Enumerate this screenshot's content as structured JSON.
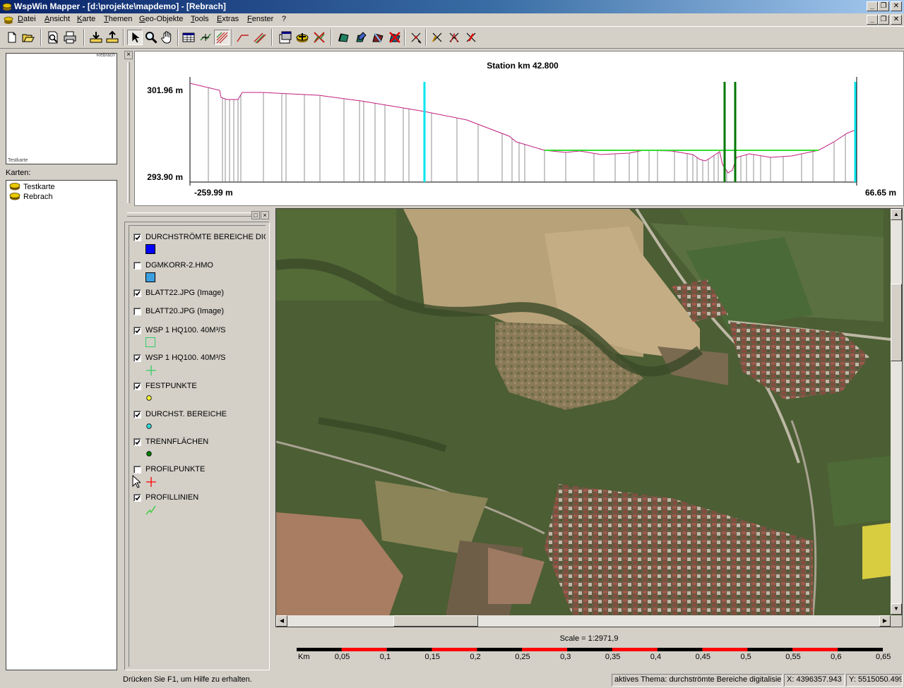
{
  "window": {
    "title": "WspWin Mapper - [d:\\projekte\\mapdemo] - [Rebrach]",
    "minimize": "_",
    "restore": "❐",
    "close": "✕"
  },
  "menu": {
    "items": [
      "Datei",
      "Ansicht",
      "Karte",
      "Themen",
      "Geo-Objekte",
      "Tools",
      "Extras",
      "Fenster",
      "?"
    ]
  },
  "left_panel": {
    "overview_label_top": "Rebrach",
    "overview_label_bottom": "Testkarte",
    "karten_label": "Karten:",
    "karten": [
      {
        "name": "Testkarte"
      },
      {
        "name": "Rebrach"
      }
    ]
  },
  "profile": {
    "title": "Station km 42.800",
    "y_max_label": "301.96 m",
    "y_min_label": "293.90 m",
    "x_min_label": "-259.99 m",
    "x_max_label": "66.65 m",
    "close": "×"
  },
  "legend": {
    "close": "×",
    "restore": "□",
    "layers": [
      {
        "name": "DURCHSTRÖMTE BEREICHE DIG",
        "checked": true,
        "symbol": "filled-square",
        "color": "#0000ff"
      },
      {
        "name": "DGMKORR-2.HMO",
        "checked": false,
        "symbol": "filled-square",
        "color": "#3c9fdf"
      },
      {
        "name": "BLATT22.JPG (Image)",
        "checked": true,
        "symbol": "none"
      },
      {
        "name": "BLATT20.JPG (Image)",
        "checked": false,
        "symbol": "none"
      },
      {
        "name": "WSP 1 HQ100. 40M³/S",
        "checked": true,
        "symbol": "outline-square",
        "color": "#33cc66"
      },
      {
        "name": "WSP 1 HQ100. 40M³/S",
        "checked": true,
        "symbol": "plus",
        "color": "#33cc66"
      },
      {
        "name": "FESTPUNKTE",
        "checked": true,
        "symbol": "dot",
        "color": "#ffff33"
      },
      {
        "name": "DURCHST. BEREICHE",
        "checked": true,
        "symbol": "dot",
        "color": "#33dddd"
      },
      {
        "name": "TRENNFLÄCHEN",
        "checked": true,
        "symbol": "dot",
        "color": "#008000"
      },
      {
        "name": "PROFILPUNKTE",
        "checked": false,
        "symbol": "plus",
        "color": "#ff0000"
      },
      {
        "name": "PROFILLINIEN",
        "checked": true,
        "symbol": "line",
        "color": "#33cc33"
      }
    ]
  },
  "scale": {
    "text": "Scale = 1:2971,9",
    "unit": "Km",
    "ticks": [
      "0,05",
      "0,1",
      "0,15",
      "0,2",
      "0,25",
      "0,3",
      "0,35",
      "0,4",
      "0,45",
      "0,5",
      "0,55",
      "0,6",
      "0,65"
    ]
  },
  "statusbar": {
    "help": "Drücken Sie F1, um Hilfe zu erhalten.",
    "theme": "aktives Thema: durchströmte Bereiche digitalisiert",
    "x": "X: 4396357.943",
    "y": "Y: 5515050.499"
  },
  "colors": {
    "profile_line": "#c0207f",
    "water_level": "#33dd33",
    "bank_marker": "#00e5ee",
    "separator_marker": "#007700"
  }
}
